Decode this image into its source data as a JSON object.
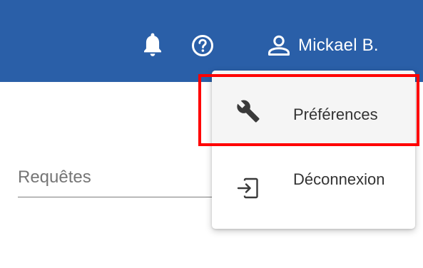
{
  "header": {
    "notifications_icon": "bell-icon",
    "help_icon": "help-circle-icon",
    "user_icon": "account-icon",
    "user_name": "Mickael B.",
    "background_color": "#2a5fa8"
  },
  "search": {
    "label": "Requêtes"
  },
  "user_menu": {
    "items": [
      {
        "label": "Préférences",
        "icon": "wrench-icon"
      },
      {
        "label": "Déconnexion",
        "icon": "logout-icon"
      }
    ]
  },
  "annotation": {
    "highlight_color": "#ff0000"
  }
}
